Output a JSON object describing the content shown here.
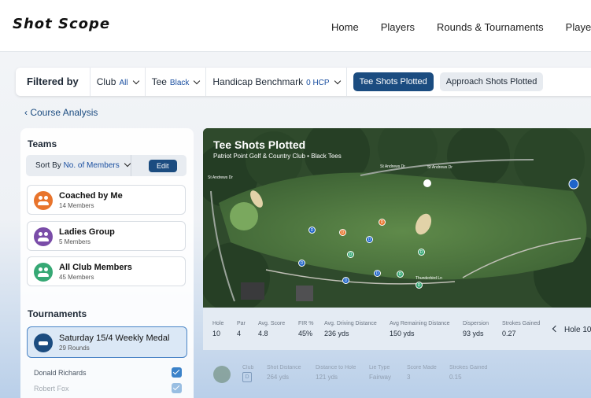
{
  "app": {
    "logo_text": "Shot Scope",
    "nav": [
      "Home",
      "Players",
      "Rounds & Tournaments",
      "Player A"
    ]
  },
  "filters": {
    "title": "Filtered by",
    "club": {
      "label": "Club",
      "value": "All"
    },
    "tee": {
      "label": "Tee",
      "value": "Black"
    },
    "handicap": {
      "label": "Handicap Benchmark",
      "value": "0 HCP"
    },
    "tabs": {
      "active": "Tee Shots Plotted",
      "inactive": "Approach Shots Plotted"
    }
  },
  "breadcrumb": {
    "back_label": "Course Analysis"
  },
  "teams": {
    "heading": "Teams",
    "sort_label": "Sort By",
    "sort_value": "No. of Members",
    "edit_label": "Edit",
    "items": [
      {
        "name": "Coached by Me",
        "members": "14 Members",
        "color": "#e8742c"
      },
      {
        "name": "Ladies Group",
        "members": "5 Members",
        "color": "#7a4ca8"
      },
      {
        "name": "All Club Members",
        "members": "45 Members",
        "color": "#36a874"
      }
    ]
  },
  "tournaments": {
    "heading": "Tournaments",
    "items": [
      {
        "name": "Saturday 15/4 Weekly Medal",
        "rounds": "29 Rounds"
      }
    ],
    "players": [
      "Donald Richards",
      "Robert Fox"
    ]
  },
  "map": {
    "title": "Tee Shots Plotted",
    "subtitle": "Patriot Point Golf & Country Club • Black Tees",
    "roads": [
      "St Andrews Dr",
      "St Andrews Dr",
      "St Andrews Dr",
      "Thunderbird Ln"
    ],
    "markers": [
      {
        "label": "D",
        "color": "blue"
      },
      {
        "label": "D",
        "color": "orange"
      },
      {
        "label": "D",
        "color": "orange"
      },
      {
        "label": "D",
        "color": "blue"
      },
      {
        "label": "D",
        "color": "green"
      },
      {
        "label": "D",
        "color": "green"
      },
      {
        "label": "D",
        "color": "blue"
      },
      {
        "label": "D",
        "color": "blue"
      },
      {
        "label": "D",
        "color": "blue"
      },
      {
        "label": "D",
        "color": "green"
      },
      {
        "label": "D",
        "color": "green"
      }
    ]
  },
  "stats": {
    "labels": [
      "Hole",
      "Par",
      "Avg. Score",
      "FIR %",
      "Avg. Driving Distance",
      "Avg Remaining Distance",
      "Dispersion",
      "Strokes Gained"
    ],
    "values": [
      "10",
      "4",
      "4.8",
      "45%",
      "236 yds",
      "150 yds",
      "93 yds",
      "0.27"
    ],
    "hole_nav": "Hole 10"
  },
  "shot_row": {
    "labels": [
      "Club",
      "Shot Distance",
      "Distance to Hole",
      "Lie Type",
      "Score Made",
      "Strokes Gained"
    ],
    "club": "D",
    "values": [
      "264 yds",
      "121 yds",
      "Fairway",
      "3",
      "0.15"
    ]
  }
}
